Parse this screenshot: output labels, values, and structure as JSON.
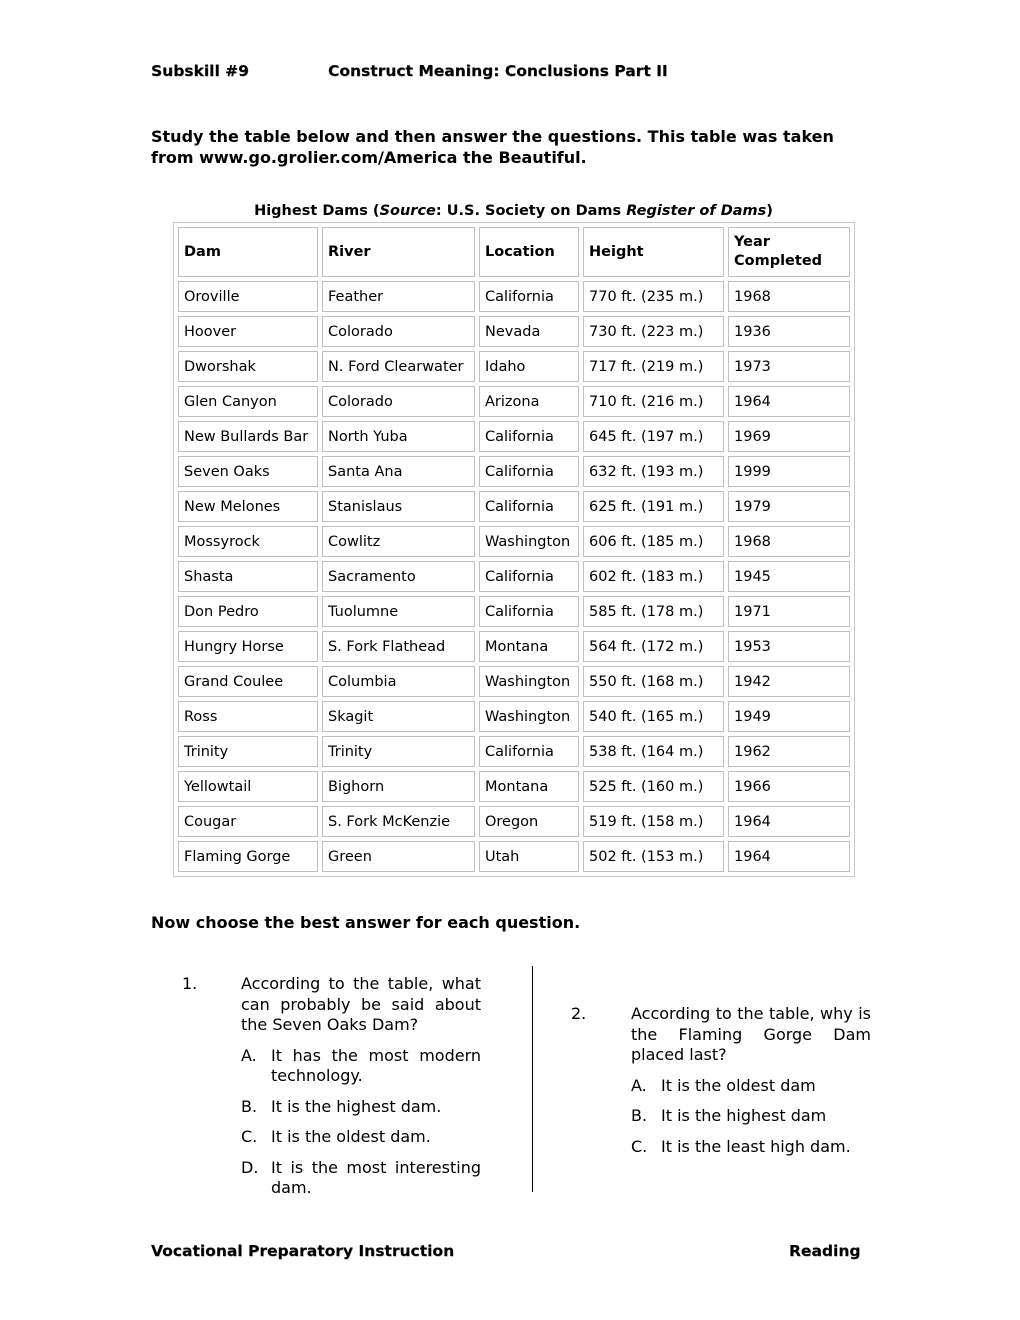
{
  "header": {
    "subskill": "Subskill #9",
    "title": "Construct Meaning: Conclusions Part II"
  },
  "intro": "Study the table below and then answer the questions. This table was taken from www.go.grolier.com/America the Beautiful.",
  "table": {
    "caption_parts": {
      "prefix": "Highest Dams (",
      "source_label": "Source",
      "middle": ": U.S. Society on Dams ",
      "register": "Register of Dams",
      "suffix": ")"
    },
    "columns": [
      "Dam",
      "River",
      "Location",
      "Height",
      "Year Completed"
    ],
    "rows": [
      [
        "Oroville",
        "Feather",
        "California",
        "770 ft. (235 m.)",
        "1968"
      ],
      [
        "Hoover",
        "Colorado",
        "Nevada",
        "730 ft. (223 m.)",
        "1936"
      ],
      [
        "Dworshak",
        "N. Ford Clearwater",
        "Idaho",
        "717 ft. (219 m.)",
        "1973"
      ],
      [
        "Glen Canyon",
        "Colorado",
        "Arizona",
        "710 ft. (216 m.)",
        "1964"
      ],
      [
        "New Bullards Bar",
        "North Yuba",
        "California",
        "645 ft. (197 m.)",
        "1969"
      ],
      [
        "Seven Oaks",
        "Santa Ana",
        "California",
        "632 ft. (193 m.)",
        "1999"
      ],
      [
        "New Melones",
        "Stanislaus",
        "California",
        "625 ft. (191 m.)",
        "1979"
      ],
      [
        "Mossyrock",
        "Cowlitz",
        "Washington",
        "606 ft. (185 m.)",
        "1968"
      ],
      [
        "Shasta",
        "Sacramento",
        "California",
        "602 ft. (183 m.)",
        "1945"
      ],
      [
        "Don Pedro",
        "Tuolumne",
        "California",
        "585 ft. (178 m.)",
        "1971"
      ],
      [
        "Hungry Horse",
        "S. Fork Flathead",
        "Montana",
        "564 ft. (172 m.)",
        "1953"
      ],
      [
        "Grand Coulee",
        "Columbia",
        "Washington",
        "550 ft. (168 m.)",
        "1942"
      ],
      [
        "Ross",
        "Skagit",
        "Washington",
        "540 ft. (165 m.)",
        "1949"
      ],
      [
        "Trinity",
        "Trinity",
        "California",
        "538 ft. (164 m.)",
        "1962"
      ],
      [
        "Yellowtail",
        "Bighorn",
        "Montana",
        "525 ft. (160 m.)",
        "1966"
      ],
      [
        "Cougar",
        "S. Fork McKenzie",
        "Oregon",
        "519 ft. (158 m.)",
        "1964"
      ],
      [
        "Flaming Gorge",
        "Green",
        "Utah",
        "502 ft. (153 m.)",
        "1964"
      ]
    ]
  },
  "instruction": "Now choose the best answer for each question.",
  "questions": [
    {
      "number": "1.",
      "text": "According to the table, what can probably be said about the Seven Oaks Dam?",
      "options": [
        {
          "letter": "A.",
          "text": "It has the most modern technology."
        },
        {
          "letter": "B.",
          "text": "It is the highest dam."
        },
        {
          "letter": "C.",
          "text": "It is the oldest dam."
        },
        {
          "letter": "D.",
          "text": "It is the most interesting dam."
        }
      ]
    },
    {
      "number": "2.",
      "text": "According to the table, why is the Flaming Gorge Dam placed last?",
      "options": [
        {
          "letter": "A.",
          "text": "It is the oldest dam"
        },
        {
          "letter": "B.",
          "text": "It is the highest dam"
        },
        {
          "letter": "C.",
          "text": "It is the least high dam."
        }
      ]
    }
  ],
  "footer": {
    "left": "Vocational Preparatory Instruction",
    "right": "Reading"
  }
}
